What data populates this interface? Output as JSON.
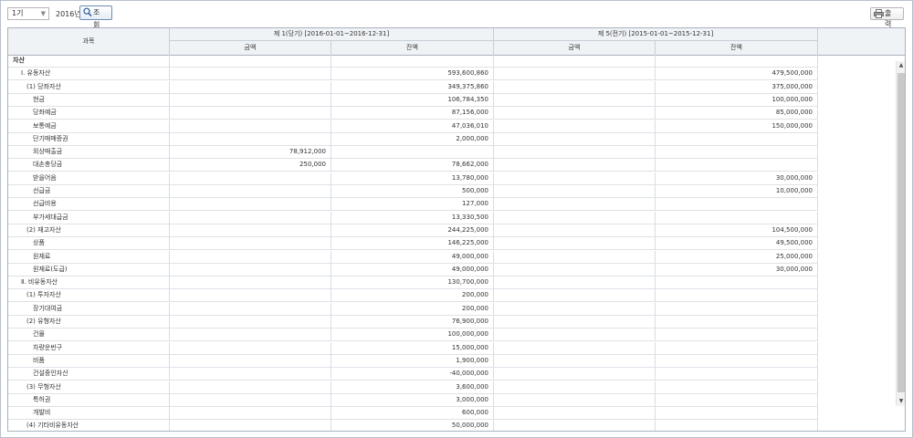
{
  "toolbar": {
    "period_select": "1기",
    "year_label": "2016년",
    "search_label": "조 회",
    "print_label": "출 력"
  },
  "header": {
    "account": "과목",
    "current_period": "제 1(당기) [2016-01-01~2016-12-31]",
    "previous_period": "제 5(전기) [2015-01-01~2015-12-31]",
    "amount": "금액",
    "balance": "잔액"
  },
  "rows": [
    {
      "name": "자산",
      "level": 0,
      "cur_amount": "",
      "cur_balance": "",
      "prev_amount": "",
      "prev_balance": ""
    },
    {
      "name": "Ⅰ. 유동자산",
      "level": 1,
      "cur_amount": "",
      "cur_balance": "593,600,860",
      "prev_amount": "",
      "prev_balance": "479,500,000"
    },
    {
      "name": "(1) 당좌자산",
      "level": 2,
      "cur_amount": "",
      "cur_balance": "349,375,860",
      "prev_amount": "",
      "prev_balance": "375,000,000"
    },
    {
      "name": "현금",
      "level": 3,
      "cur_amount": "",
      "cur_balance": "106,784,350",
      "prev_amount": "",
      "prev_balance": "100,000,000"
    },
    {
      "name": "당좌예금",
      "level": 3,
      "cur_amount": "",
      "cur_balance": "87,156,000",
      "prev_amount": "",
      "prev_balance": "85,000,000"
    },
    {
      "name": "보통예금",
      "level": 3,
      "cur_amount": "",
      "cur_balance": "47,036,010",
      "prev_amount": "",
      "prev_balance": "150,000,000"
    },
    {
      "name": "단기매매증권",
      "level": 3,
      "cur_amount": "",
      "cur_balance": "2,000,000",
      "prev_amount": "",
      "prev_balance": ""
    },
    {
      "name": "외상매출금",
      "level": 3,
      "cur_amount": "78,912,000",
      "cur_balance": "",
      "prev_amount": "",
      "prev_balance": ""
    },
    {
      "name": "대손충당금",
      "level": 3,
      "cur_amount": "250,000",
      "cur_balance": "78,662,000",
      "prev_amount": "",
      "prev_balance": ""
    },
    {
      "name": "받을어음",
      "level": 3,
      "cur_amount": "",
      "cur_balance": "13,780,000",
      "prev_amount": "",
      "prev_balance": "30,000,000"
    },
    {
      "name": "선급금",
      "level": 3,
      "cur_amount": "",
      "cur_balance": "500,000",
      "prev_amount": "",
      "prev_balance": "10,000,000"
    },
    {
      "name": "선급비용",
      "level": 3,
      "cur_amount": "",
      "cur_balance": "127,000",
      "prev_amount": "",
      "prev_balance": ""
    },
    {
      "name": "부가세대급금",
      "level": 3,
      "cur_amount": "",
      "cur_balance": "13,330,500",
      "prev_amount": "",
      "prev_balance": ""
    },
    {
      "name": "(2) 재고자산",
      "level": 2,
      "cur_amount": "",
      "cur_balance": "244,225,000",
      "prev_amount": "",
      "prev_balance": "104,500,000"
    },
    {
      "name": "상품",
      "level": 3,
      "cur_amount": "",
      "cur_balance": "146,225,000",
      "prev_amount": "",
      "prev_balance": "49,500,000"
    },
    {
      "name": "원재료",
      "level": 3,
      "cur_amount": "",
      "cur_balance": "49,000,000",
      "prev_amount": "",
      "prev_balance": "25,000,000"
    },
    {
      "name": "원재료(도급)",
      "level": 3,
      "cur_amount": "",
      "cur_balance": "49,000,000",
      "prev_amount": "",
      "prev_balance": "30,000,000"
    },
    {
      "name": "Ⅱ. 비유동자산",
      "level": 1,
      "cur_amount": "",
      "cur_balance": "130,700,000",
      "prev_amount": "",
      "prev_balance": ""
    },
    {
      "name": "(1) 투자자산",
      "level": 2,
      "cur_amount": "",
      "cur_balance": "200,000",
      "prev_amount": "",
      "prev_balance": ""
    },
    {
      "name": "장기대여금",
      "level": 3,
      "cur_amount": "",
      "cur_balance": "200,000",
      "prev_amount": "",
      "prev_balance": ""
    },
    {
      "name": "(2) 유형자산",
      "level": 2,
      "cur_amount": "",
      "cur_balance": "76,900,000",
      "prev_amount": "",
      "prev_balance": ""
    },
    {
      "name": "건물",
      "level": 3,
      "cur_amount": "",
      "cur_balance": "100,000,000",
      "prev_amount": "",
      "prev_balance": ""
    },
    {
      "name": "차량운반구",
      "level": 3,
      "cur_amount": "",
      "cur_balance": "15,000,000",
      "prev_amount": "",
      "prev_balance": ""
    },
    {
      "name": "비품",
      "level": 3,
      "cur_amount": "",
      "cur_balance": "1,900,000",
      "prev_amount": "",
      "prev_balance": ""
    },
    {
      "name": "건설중인자산",
      "level": 3,
      "cur_amount": "",
      "cur_balance": "-40,000,000",
      "prev_amount": "",
      "prev_balance": ""
    },
    {
      "name": "(3) 무형자산",
      "level": 2,
      "cur_amount": "",
      "cur_balance": "3,600,000",
      "prev_amount": "",
      "prev_balance": ""
    },
    {
      "name": "특허권",
      "level": 3,
      "cur_amount": "",
      "cur_balance": "3,000,000",
      "prev_amount": "",
      "prev_balance": ""
    },
    {
      "name": "개발비",
      "level": 3,
      "cur_amount": "",
      "cur_balance": "600,000",
      "prev_amount": "",
      "prev_balance": ""
    },
    {
      "name": "(4) 기타비유동자산",
      "level": 2,
      "cur_amount": "",
      "cur_balance": "50,000,000",
      "prev_amount": "",
      "prev_balance": ""
    }
  ]
}
